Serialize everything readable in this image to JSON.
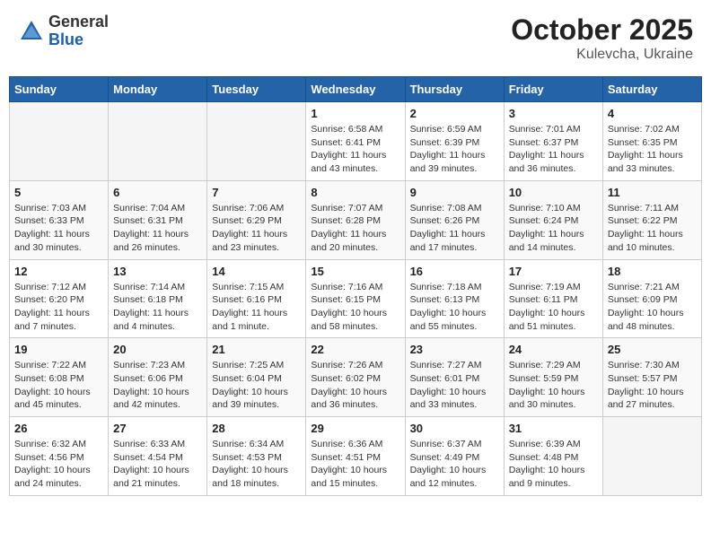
{
  "header": {
    "logo_general": "General",
    "logo_blue": "Blue",
    "month_title": "October 2025",
    "subtitle": "Kulevcha, Ukraine"
  },
  "weekdays": [
    "Sunday",
    "Monday",
    "Tuesday",
    "Wednesday",
    "Thursday",
    "Friday",
    "Saturday"
  ],
  "weeks": [
    [
      {
        "day": null
      },
      {
        "day": null
      },
      {
        "day": null
      },
      {
        "day": "1",
        "sunrise": "Sunrise: 6:58 AM",
        "sunset": "Sunset: 6:41 PM",
        "daylight": "Daylight: 11 hours and 43 minutes."
      },
      {
        "day": "2",
        "sunrise": "Sunrise: 6:59 AM",
        "sunset": "Sunset: 6:39 PM",
        "daylight": "Daylight: 11 hours and 39 minutes."
      },
      {
        "day": "3",
        "sunrise": "Sunrise: 7:01 AM",
        "sunset": "Sunset: 6:37 PM",
        "daylight": "Daylight: 11 hours and 36 minutes."
      },
      {
        "day": "4",
        "sunrise": "Sunrise: 7:02 AM",
        "sunset": "Sunset: 6:35 PM",
        "daylight": "Daylight: 11 hours and 33 minutes."
      }
    ],
    [
      {
        "day": "5",
        "sunrise": "Sunrise: 7:03 AM",
        "sunset": "Sunset: 6:33 PM",
        "daylight": "Daylight: 11 hours and 30 minutes."
      },
      {
        "day": "6",
        "sunrise": "Sunrise: 7:04 AM",
        "sunset": "Sunset: 6:31 PM",
        "daylight": "Daylight: 11 hours and 26 minutes."
      },
      {
        "day": "7",
        "sunrise": "Sunrise: 7:06 AM",
        "sunset": "Sunset: 6:29 PM",
        "daylight": "Daylight: 11 hours and 23 minutes."
      },
      {
        "day": "8",
        "sunrise": "Sunrise: 7:07 AM",
        "sunset": "Sunset: 6:28 PM",
        "daylight": "Daylight: 11 hours and 20 minutes."
      },
      {
        "day": "9",
        "sunrise": "Sunrise: 7:08 AM",
        "sunset": "Sunset: 6:26 PM",
        "daylight": "Daylight: 11 hours and 17 minutes."
      },
      {
        "day": "10",
        "sunrise": "Sunrise: 7:10 AM",
        "sunset": "Sunset: 6:24 PM",
        "daylight": "Daylight: 11 hours and 14 minutes."
      },
      {
        "day": "11",
        "sunrise": "Sunrise: 7:11 AM",
        "sunset": "Sunset: 6:22 PM",
        "daylight": "Daylight: 11 hours and 10 minutes."
      }
    ],
    [
      {
        "day": "12",
        "sunrise": "Sunrise: 7:12 AM",
        "sunset": "Sunset: 6:20 PM",
        "daylight": "Daylight: 11 hours and 7 minutes."
      },
      {
        "day": "13",
        "sunrise": "Sunrise: 7:14 AM",
        "sunset": "Sunset: 6:18 PM",
        "daylight": "Daylight: 11 hours and 4 minutes."
      },
      {
        "day": "14",
        "sunrise": "Sunrise: 7:15 AM",
        "sunset": "Sunset: 6:16 PM",
        "daylight": "Daylight: 11 hours and 1 minute."
      },
      {
        "day": "15",
        "sunrise": "Sunrise: 7:16 AM",
        "sunset": "Sunset: 6:15 PM",
        "daylight": "Daylight: 10 hours and 58 minutes."
      },
      {
        "day": "16",
        "sunrise": "Sunrise: 7:18 AM",
        "sunset": "Sunset: 6:13 PM",
        "daylight": "Daylight: 10 hours and 55 minutes."
      },
      {
        "day": "17",
        "sunrise": "Sunrise: 7:19 AM",
        "sunset": "Sunset: 6:11 PM",
        "daylight": "Daylight: 10 hours and 51 minutes."
      },
      {
        "day": "18",
        "sunrise": "Sunrise: 7:21 AM",
        "sunset": "Sunset: 6:09 PM",
        "daylight": "Daylight: 10 hours and 48 minutes."
      }
    ],
    [
      {
        "day": "19",
        "sunrise": "Sunrise: 7:22 AM",
        "sunset": "Sunset: 6:08 PM",
        "daylight": "Daylight: 10 hours and 45 minutes."
      },
      {
        "day": "20",
        "sunrise": "Sunrise: 7:23 AM",
        "sunset": "Sunset: 6:06 PM",
        "daylight": "Daylight: 10 hours and 42 minutes."
      },
      {
        "day": "21",
        "sunrise": "Sunrise: 7:25 AM",
        "sunset": "Sunset: 6:04 PM",
        "daylight": "Daylight: 10 hours and 39 minutes."
      },
      {
        "day": "22",
        "sunrise": "Sunrise: 7:26 AM",
        "sunset": "Sunset: 6:02 PM",
        "daylight": "Daylight: 10 hours and 36 minutes."
      },
      {
        "day": "23",
        "sunrise": "Sunrise: 7:27 AM",
        "sunset": "Sunset: 6:01 PM",
        "daylight": "Daylight: 10 hours and 33 minutes."
      },
      {
        "day": "24",
        "sunrise": "Sunrise: 7:29 AM",
        "sunset": "Sunset: 5:59 PM",
        "daylight": "Daylight: 10 hours and 30 minutes."
      },
      {
        "day": "25",
        "sunrise": "Sunrise: 7:30 AM",
        "sunset": "Sunset: 5:57 PM",
        "daylight": "Daylight: 10 hours and 27 minutes."
      }
    ],
    [
      {
        "day": "26",
        "sunrise": "Sunrise: 6:32 AM",
        "sunset": "Sunset: 4:56 PM",
        "daylight": "Daylight: 10 hours and 24 minutes."
      },
      {
        "day": "27",
        "sunrise": "Sunrise: 6:33 AM",
        "sunset": "Sunset: 4:54 PM",
        "daylight": "Daylight: 10 hours and 21 minutes."
      },
      {
        "day": "28",
        "sunrise": "Sunrise: 6:34 AM",
        "sunset": "Sunset: 4:53 PM",
        "daylight": "Daylight: 10 hours and 18 minutes."
      },
      {
        "day": "29",
        "sunrise": "Sunrise: 6:36 AM",
        "sunset": "Sunset: 4:51 PM",
        "daylight": "Daylight: 10 hours and 15 minutes."
      },
      {
        "day": "30",
        "sunrise": "Sunrise: 6:37 AM",
        "sunset": "Sunset: 4:49 PM",
        "daylight": "Daylight: 10 hours and 12 minutes."
      },
      {
        "day": "31",
        "sunrise": "Sunrise: 6:39 AM",
        "sunset": "Sunset: 4:48 PM",
        "daylight": "Daylight: 10 hours and 9 minutes."
      },
      {
        "day": null
      }
    ]
  ]
}
